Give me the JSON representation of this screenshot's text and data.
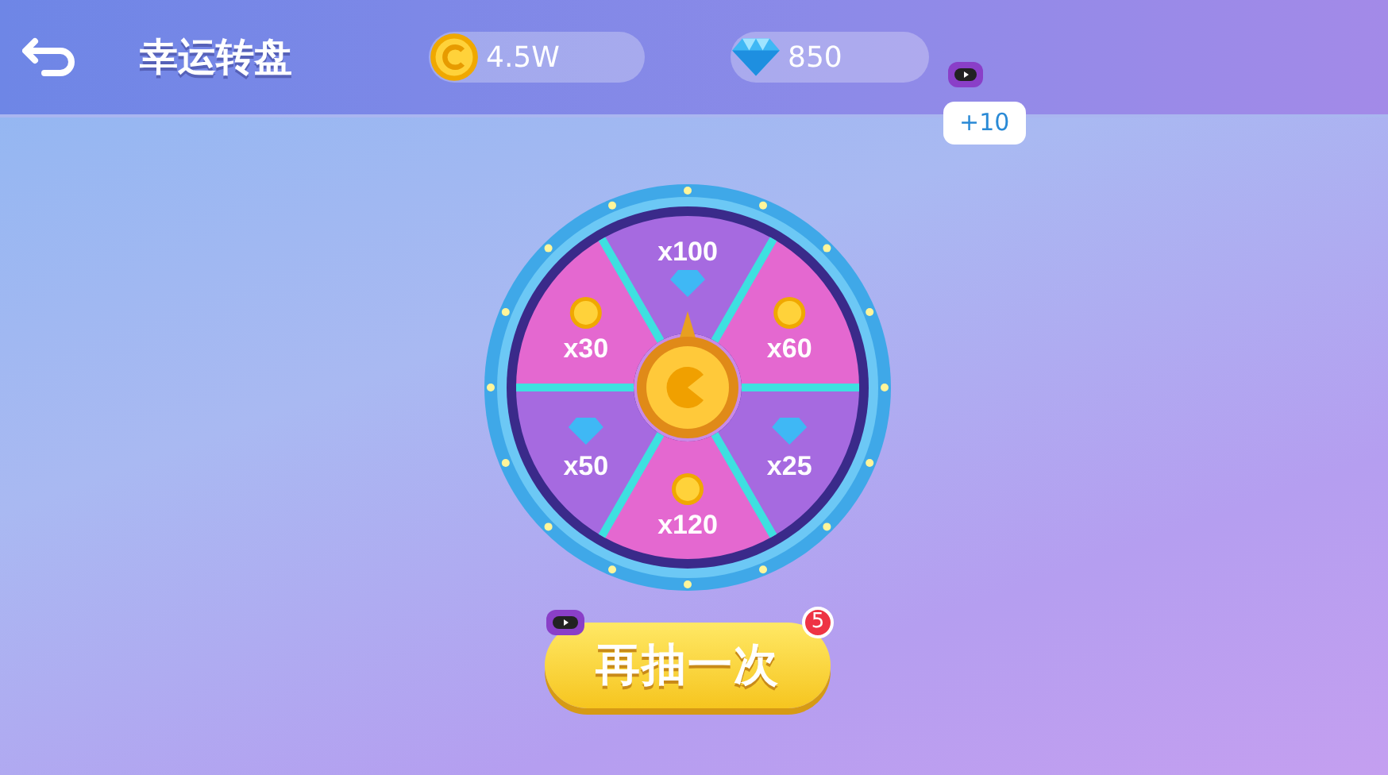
{
  "header": {
    "title": "幸运转盘"
  },
  "balances": [
    {
      "kind": "coin",
      "value": "4.5W"
    },
    {
      "kind": "diamond",
      "value": "850"
    }
  ],
  "video_bonus": {
    "reward": "+10"
  },
  "wheel": {
    "segments": [
      {
        "label": "x100",
        "kind": "diamond"
      },
      {
        "label": "x60",
        "kind": "coin"
      },
      {
        "label": "x25",
        "kind": "diamond"
      },
      {
        "label": "x120",
        "kind": "coin"
      },
      {
        "label": "x50",
        "kind": "diamond"
      },
      {
        "label": "x30",
        "kind": "coin"
      }
    ]
  },
  "spin_button": {
    "label": "再抽一次",
    "badge": "5"
  }
}
